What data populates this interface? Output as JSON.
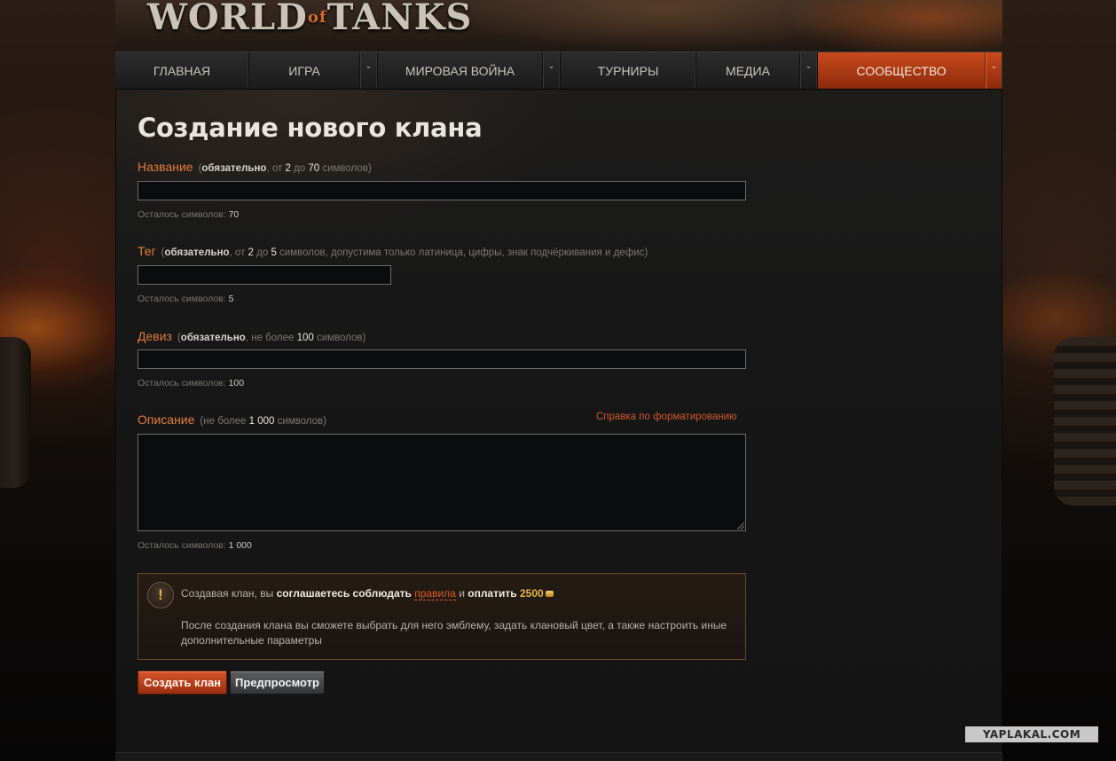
{
  "header": {
    "logo_part1": "WORLD",
    "logo_part2": "of",
    "logo_part3": "TANKS"
  },
  "nav": {
    "items": [
      {
        "label": "ГЛАВНАЯ",
        "has_dropdown": false,
        "active": false
      },
      {
        "label": "ИГРА",
        "has_dropdown": true,
        "active": false
      },
      {
        "label": "МИРОВАЯ ВОЙНА",
        "has_dropdown": true,
        "active": false
      },
      {
        "label": "ТУРНИРЫ",
        "has_dropdown": false,
        "active": false
      },
      {
        "label": "МЕДИА",
        "has_dropdown": true,
        "active": false
      },
      {
        "label": "СООБЩЕСТВО",
        "has_dropdown": true,
        "active": true
      }
    ],
    "dropdown_glyph": "⌄"
  },
  "page": {
    "title": "Создание нового клана"
  },
  "form": {
    "name": {
      "label": "Название",
      "hint_open": "(",
      "hint_required": "обязательно",
      "hint_from": ", от ",
      "hint_min": "2",
      "hint_to": " до ",
      "hint_max": "70",
      "hint_rest": " символов)",
      "value": "",
      "counter_label": "Осталось символов: ",
      "counter_value": "70"
    },
    "tag": {
      "label": "Тег",
      "hint_open": "(",
      "hint_required": "обязательно",
      "hint_from": ", от ",
      "hint_min": "2",
      "hint_to": " до ",
      "hint_max": "5",
      "hint_rest": " символов, допустима только латиница, цифры, знак подчёркивания и дефис)",
      "value": "",
      "counter_label": "Осталось символов: ",
      "counter_value": "5"
    },
    "motto": {
      "label": "Девиз",
      "hint_open": "(",
      "hint_required": "обязательно",
      "hint_mid": ", не более ",
      "hint_max": "100",
      "hint_rest": " символов)",
      "value": "",
      "counter_label": "Осталось символов: ",
      "counter_value": "100"
    },
    "description": {
      "label": "Описание",
      "hint_open": "(не более ",
      "hint_max": "1 000",
      "hint_rest": " символов)",
      "help_link": "Справка по форматированию",
      "value": "",
      "counter_label": "Осталось символов: ",
      "counter_value": "1 000"
    }
  },
  "notice": {
    "icon": "!",
    "line1_pre": "Создавая клан, вы ",
    "line1_agree": "соглашаетесь соблюдать",
    "line1_space": " ",
    "line1_rules": "правила",
    "line1_and": " и ",
    "line1_pay": "оплатить",
    "line1_space2": " ",
    "line1_price": "2500",
    "line2": "После создания клана вы сможете выбрать для него эмблему, задать клановый цвет, а также настроить иные дополнительные параметры"
  },
  "buttons": {
    "create": "Создать клан",
    "preview": "Предпросмотр"
  },
  "watermark": "YAPLAKAL.COM"
}
